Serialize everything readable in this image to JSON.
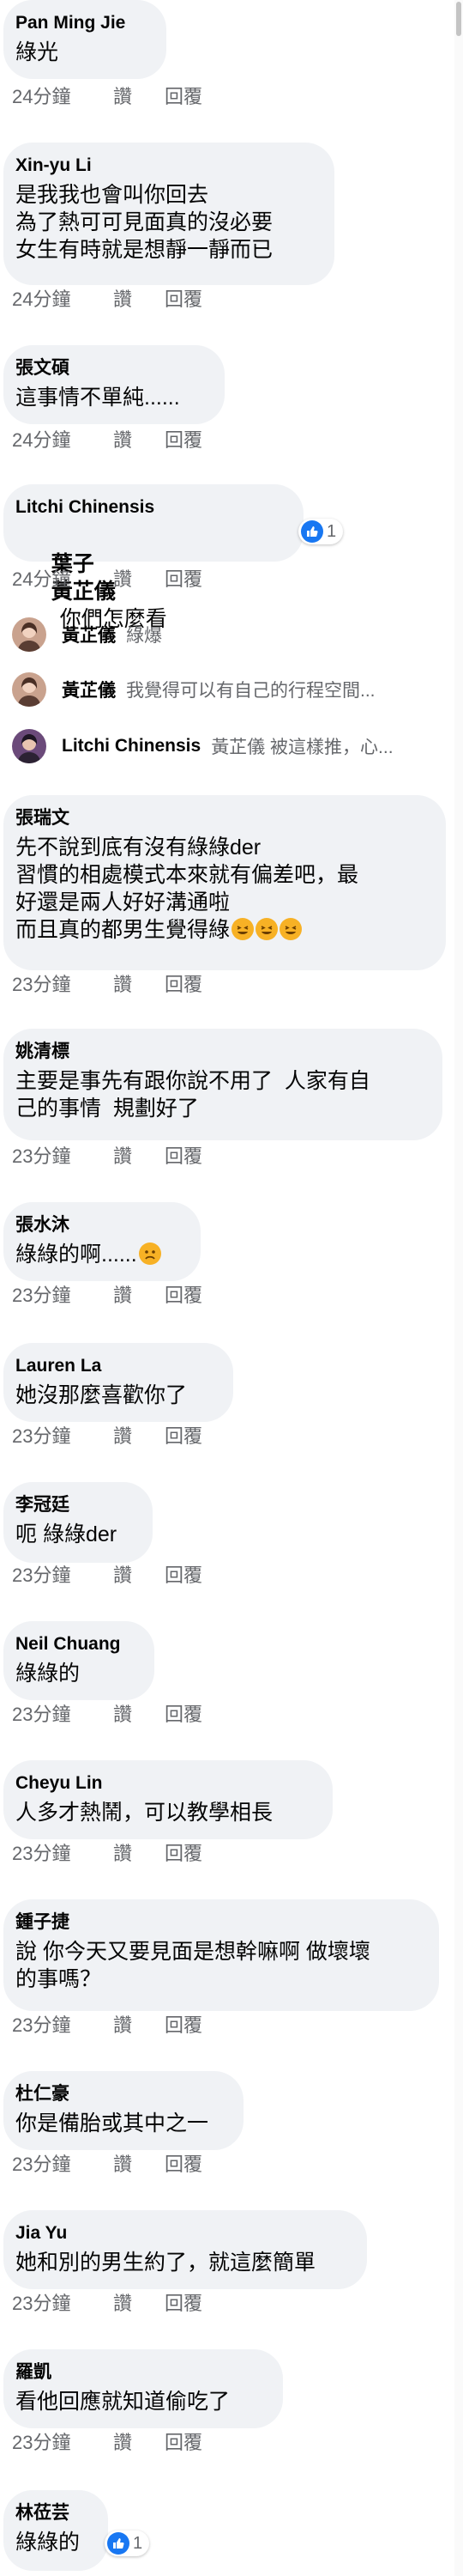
{
  "actions": {
    "like": "讚",
    "reply": "回覆"
  },
  "colors": {
    "bubble": "#f0f2f5",
    "meta_text": "#65676b",
    "like_blue": "#1877f2",
    "emoji_yellow": "#f7b125"
  },
  "comments": [
    {
      "name": "Pan Ming Jie",
      "text": "綠光",
      "time": "24分鐘"
    },
    {
      "name": "Xin-yu Li",
      "text": "是我我也會叫你回去\n為了熱可可見面真的沒必要\n女生有時就是想靜一靜而已",
      "time": "24分鐘"
    },
    {
      "name": "張文碩",
      "text": "這事情不單純......",
      "time": "24分鐘"
    },
    {
      "name": "Litchi Chinensis",
      "text_tags": [
        "葉子",
        "黃芷儀"
      ],
      "text_rest": "你們怎麼看",
      "time": "24分鐘",
      "reaction_count": "1",
      "reaction_icon": "like-icon",
      "replies": [
        {
          "name": "黃芷儀",
          "text": "綠爆"
        },
        {
          "name": "黃芷儀",
          "text": "我覺得可以有自己的行程空間..."
        },
        {
          "name": "Litchi Chinensis",
          "text": "黃芷儀 被這樣推，心..."
        }
      ]
    },
    {
      "name": "張瑞文",
      "text": "先不說到底有沒有綠綠der\n習慣的相處模式本來就有偏差吧，最\n好還是兩人好好溝通啦\n而且真的都男生覺得綠",
      "emoji": "rolling-laughing-emoji",
      "time": "23分鐘"
    },
    {
      "name": "姚清標",
      "text": "主要是事先有跟你說不用了  人家有自\n己的事情  規劃好了",
      "time": "23分鐘"
    },
    {
      "name": "張水沐",
      "text": "綠綠的啊......",
      "emoji": "worried-face-emoji",
      "time": "23分鐘"
    },
    {
      "name": "Lauren La",
      "text": "她沒那麼喜歡你了",
      "time": "23分鐘"
    },
    {
      "name": "李冠廷",
      "text": "呃 綠綠der",
      "time": "23分鐘"
    },
    {
      "name": "Neil Chuang",
      "text": "綠綠的",
      "time": "23分鐘"
    },
    {
      "name": "Cheyu Lin",
      "text": "人多才熱鬧，可以教學相長",
      "time": "23分鐘"
    },
    {
      "name": "鍾子捷",
      "text": "說 你今天又要見面是想幹嘛啊 做壞壞\n的事嗎？",
      "time": "23分鐘"
    },
    {
      "name": "杜仁豪",
      "text": "你是備胎或其中之一",
      "time": "23分鐘"
    },
    {
      "name": "Jia Yu",
      "text": "她和別的男生約了，就這麼簡單",
      "time": "23分鐘"
    },
    {
      "name": "羅凱",
      "text": "看他回應就知道偷吃了",
      "time": "23分鐘"
    },
    {
      "name": "林莅芸",
      "text": "綠綠的",
      "reaction_count": "1",
      "reaction_icon": "like-icon"
    }
  ]
}
